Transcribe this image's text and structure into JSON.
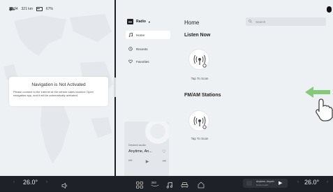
{
  "status_bar": {
    "time": "16:34",
    "range": "321 km",
    "battery": "67%"
  },
  "navigation": {
    "title": "Navigation is Not Activated",
    "message": "Please connect to the internet at the vehicle sales location. Open navigation app, and it will be automatically activated."
  },
  "sidebar": {
    "source_label": "Radio",
    "items": [
      {
        "label": "Home",
        "icon": "music-note-icon",
        "active": true
      },
      {
        "label": "Recents",
        "icon": "clock-icon",
        "active": false
      },
      {
        "label": "Favorites",
        "icon": "heart-outline-icon",
        "active": false
      }
    ]
  },
  "mini_player": {
    "label": "Desired audio",
    "title": "Anytime, An..."
  },
  "main": {
    "title": "Home",
    "search_placeholder": "Search",
    "sections": [
      {
        "title": "Listen Now",
        "scan_label": "Tap To Scan"
      },
      {
        "title": "FM/AM Stations",
        "scan_label": "Tap To Scan"
      }
    ]
  },
  "bottom_bar": {
    "left_temp": "26.0°",
    "right_temp": "26.0°",
    "now_playing_title": "Anytime, Anywh",
    "now_playing_sub": "Desired audio"
  },
  "colors": {
    "accent": "#86c97a",
    "panel": "#eef1f4",
    "bar": "#1f2128"
  }
}
